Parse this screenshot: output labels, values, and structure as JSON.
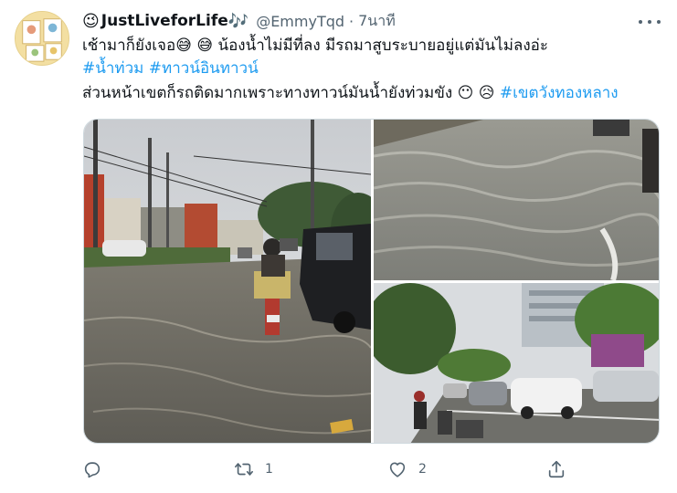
{
  "tweet": {
    "display_name": "JustLiveforLife",
    "name_prefix_emoji": "😉",
    "name_suffix_emoji": "🎶",
    "handle": "@EmmyTqd",
    "separator": "·",
    "time": "7นาที",
    "line1": "เช้ามาก็ยังเจอ",
    "line1_emoji": "😅 😅",
    "line1_rest": "น้องน้ำไม่มีที่ลง มีรถมาสูบระบายอยู่แต่มันไม่ลงอ่ะ",
    "hashtag1": "#น้ำท่วม",
    "hashtag2": "#ทาวน์อินทาวน์",
    "line3": "ส่วนหน้าเขตก็รถติดมากเพราะทางทาวน์มันน้ำยังท่วมขัง",
    "line3_emoji": "😶 😥",
    "hashtag3": "#เขตวังทองหลาง"
  },
  "actions": {
    "reply_count": "",
    "retweet_count": "1",
    "like_count": "2"
  },
  "icons": {
    "more": "more-icon",
    "reply": "reply-icon",
    "retweet": "retweet-icon",
    "like": "heart-icon",
    "share": "share-icon"
  },
  "colors": {
    "link": "#1d9bf0",
    "secondary_text": "#536471",
    "primary_text": "#0f1419"
  }
}
